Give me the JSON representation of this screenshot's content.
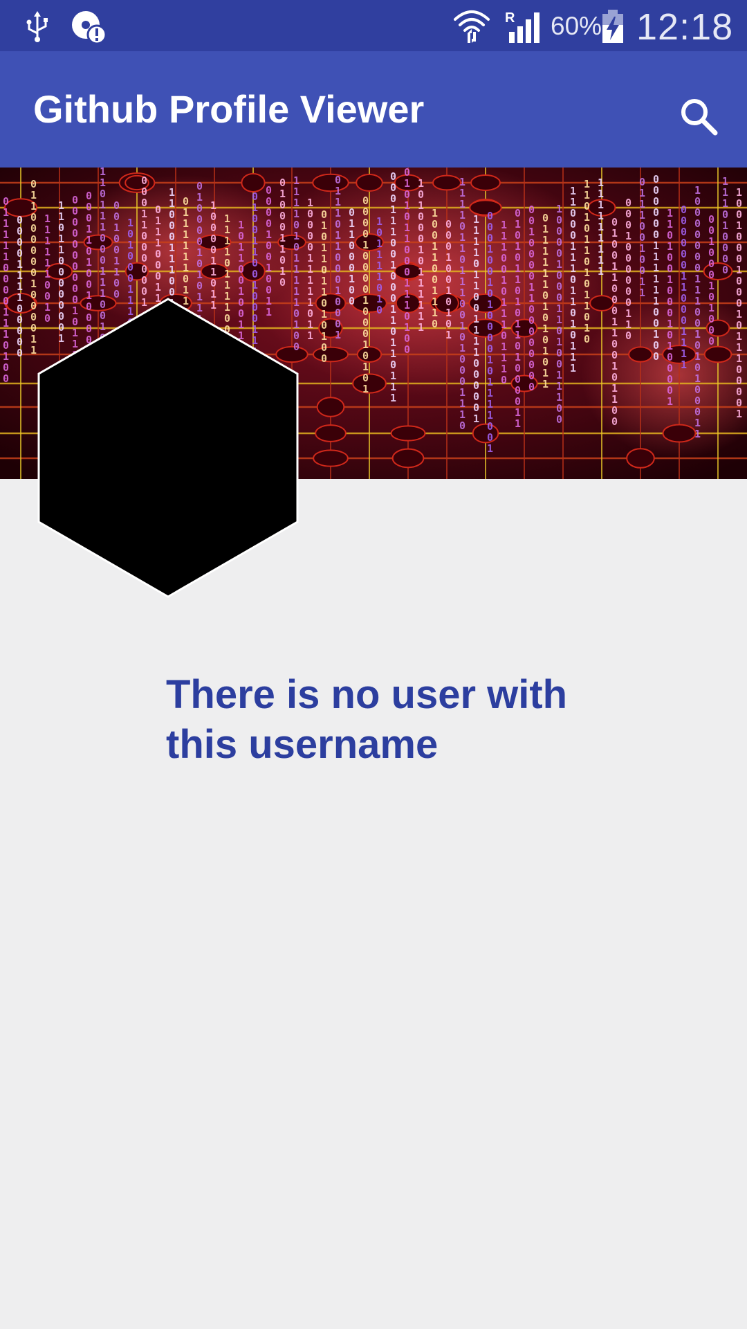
{
  "status_bar": {
    "battery_percent": "60%",
    "time": "12:18",
    "icons": [
      "usb-icon",
      "sync-alert-icon",
      "wifi-icon",
      "signal-icon",
      "battery-charging-icon"
    ],
    "signal_roaming_label": "R"
  },
  "app_bar": {
    "title": "Github Profile Viewer",
    "search_icon": "search-icon",
    "color": "#3f51b5"
  },
  "header": {
    "image": "circuit-binary-banner"
  },
  "avatar": {
    "shape": "hexagon",
    "fill": "#000000"
  },
  "message": {
    "text": "There is no user with this username",
    "color": "#2c3e9f"
  }
}
